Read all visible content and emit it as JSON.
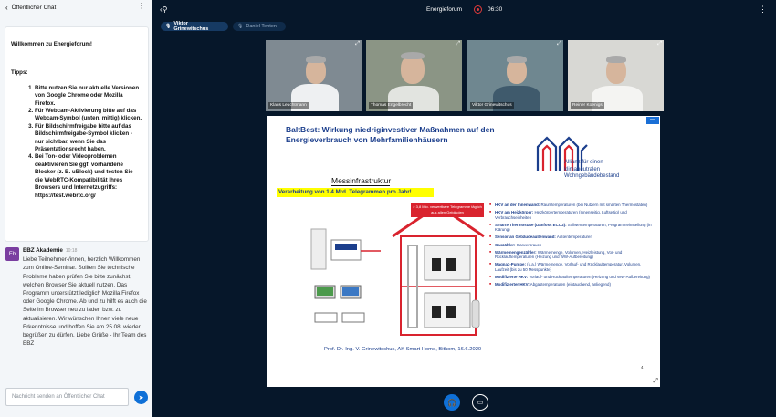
{
  "chat": {
    "title": "Öffentlicher Chat",
    "welcome": {
      "greeting": "Willkommen zu Energieforum!",
      "tips_heading": "Tipps:",
      "tips": [
        "Bitte nutzen Sie nur aktuelle Versionen von Google Chrome oder Mozilla Firefox.",
        "Für Webcam-Aktivierung bitte auf das Webcam-Symbol (unten, mittig) klicken.",
        "Für Bildschirmfreigabe bitte auf das Bildschirmfreigabe-Symbol klicken - nur sichtbar, wenn Sie das Präsentationsrecht haben.",
        "Bei Ton- oder Videoproblemen deaktivieren Sie ggf. vorhandene Blocker (z. B. uBlock) und testen Sie die WebRTC-Kompatibilität Ihres Browsers und Internetzugriffs: https://test.webrtc.org/"
      ]
    },
    "message": {
      "avatar": "Eb",
      "author": "EBZ Akademie",
      "time": "10:18",
      "text": "Liebe Teilnehmer-/innen, herzlich Willkommen zum Online-Seminar. Sollten Sie technische Probleme haben prüfen Sie bitte zunächst, welchen Browser Sie aktuell nutzen. Das Programm unterstützt lediglich Mozilla Firefox oder Google Chrome. Ab und zu hilft es auch die Seite im Browser neu zu laden bzw. zu aktualisieren. Wir wünschen Ihnen viele neue Erkenntnisse und hoffen Sie am 25.08. wieder begrüßen zu dürfen. Liebe Grüße - Ihr Team des EBZ"
    },
    "input_placeholder": "Nachricht senden an Öffentlicher Chat"
  },
  "topbar": {
    "title": "Energieforum",
    "clock": "06:30"
  },
  "presenters": [
    "Viktor Grinewitschus",
    "Daniel Tenten"
  ],
  "videos": [
    {
      "name": "Klaus Leuchtmann",
      "bg": "#7f8a92",
      "shirt": "#eef0f2"
    },
    {
      "name": "Thomas Engelbrecht",
      "bg": "#8b9585",
      "shirt": "#e2e4e0"
    },
    {
      "name": "Viktor Grinewitschus",
      "bg": "#6f8790",
      "shirt": "#3f5a6c"
    },
    {
      "name": "Reiner Koenigs",
      "bg": "#d8d8d4",
      "shirt": "#f4f4f2"
    }
  ],
  "slide": {
    "title": "BaltBest: Wirkung niedriginvestiver Maßnahmen auf den Energieverbrauch von Mehrfamilienhäusern",
    "logo_text": [
      "Allianz für einen",
      "klimaneutralen",
      "Wohngebäudebestand"
    ],
    "section": "Messinfrastruktur",
    "highlight": "Verarbeitung von 1,4 Mrd. Telegrammen pro Jahr!",
    "redbox": "> 3,8 Mio. verwertbare Telegramme täglich aus allen Gebäuden",
    "bullets": [
      {
        "b": "HKV an der Innenwand:",
        "t": " Raumtemperaturen (bei Nutzern mit smarten Thermostaten)"
      },
      {
        "b": "HKV am Heizkörper:",
        "t": " Heizkörpertemperaturen (Innenseitig, Luftseitig) und Verbrauchseinheiten"
      },
      {
        "b": "Smarte Thermostate (Danfoss ECO2):",
        "t": " Sollwerttemperaturen, Programmeinstellung (in Klärung)"
      },
      {
        "b": "Sensor an Gebäudeaußenwand:",
        "t": " Außentemperaturen"
      },
      {
        "b": "Gaszähler:",
        "t": " Gasverbrauch"
      },
      {
        "b": "Wärmemengenzähler:",
        "t": " Wärmemenge, Volumen, Heizleistung, Vor- und Rücklauftemperaturen (Heizung und WW-Aufbereitung)"
      },
      {
        "b": "Magna3-Pumpe:",
        "t": " (u.a.) Wärmemenge, Vorlauf- und Rücklauftemperatur, Volumen, Laufzeit (bis zu 50 Messpunkte)"
      },
      {
        "b": "Modifizierte HKV:",
        "t": " Vorlauf- und Rücklauftemperaturen (Heizung und WW-Aufbereitung)"
      },
      {
        "b": "Modifizierter HKV:",
        "t": " Abgastemperaturen (eintauchend, anliegend)"
      }
    ],
    "footer": "Prof. Dr.-Ing. V. Grinewitschus, AK Smart Home, Bitkom, 16.6.2020",
    "page": "4",
    "minimize": "—"
  },
  "colors": {
    "accent": "#0f70d7",
    "background": "#06172a",
    "record": "#e03a3a"
  }
}
